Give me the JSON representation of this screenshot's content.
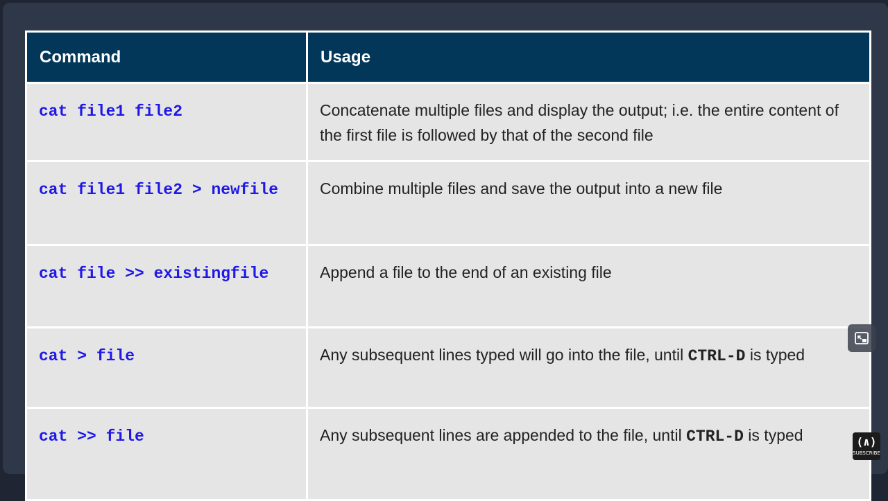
{
  "table": {
    "headers": {
      "command": "Command",
      "usage": "Usage"
    },
    "rows": [
      {
        "command": "cat file1 file2",
        "usage": "Concatenate multiple files and display the output; i.e. the entire content of the first file is followed by that of the second file"
      },
      {
        "command": "cat file1 file2 > newfile",
        "usage": "Combine multiple files and save the output into a new file"
      },
      {
        "command": "cat file >> existingfile",
        "usage": "Append a file to the end of an existing file"
      },
      {
        "command": "cat > file",
        "usage_before": "Any subsequent lines typed will go into the file, until ",
        "usage_key": "CTRL-D",
        "usage_after": " is typed"
      },
      {
        "command": "cat >> file",
        "usage_before": "Any subsequent lines are appended to the file, until ",
        "usage_key": "CTRL-D",
        "usage_after": " is typed"
      }
    ]
  },
  "overlay": {
    "side_button_icon": "picture-in-picture-icon",
    "brand_logo_icon": "freecodecamp-logo-icon",
    "brand_label": "SUBSCRIBE"
  },
  "colors": {
    "header_bg": "#02375a",
    "command_text": "#1f18e6",
    "cell_bg": "#e5e5e5",
    "frame_bg": "#2f3848"
  }
}
